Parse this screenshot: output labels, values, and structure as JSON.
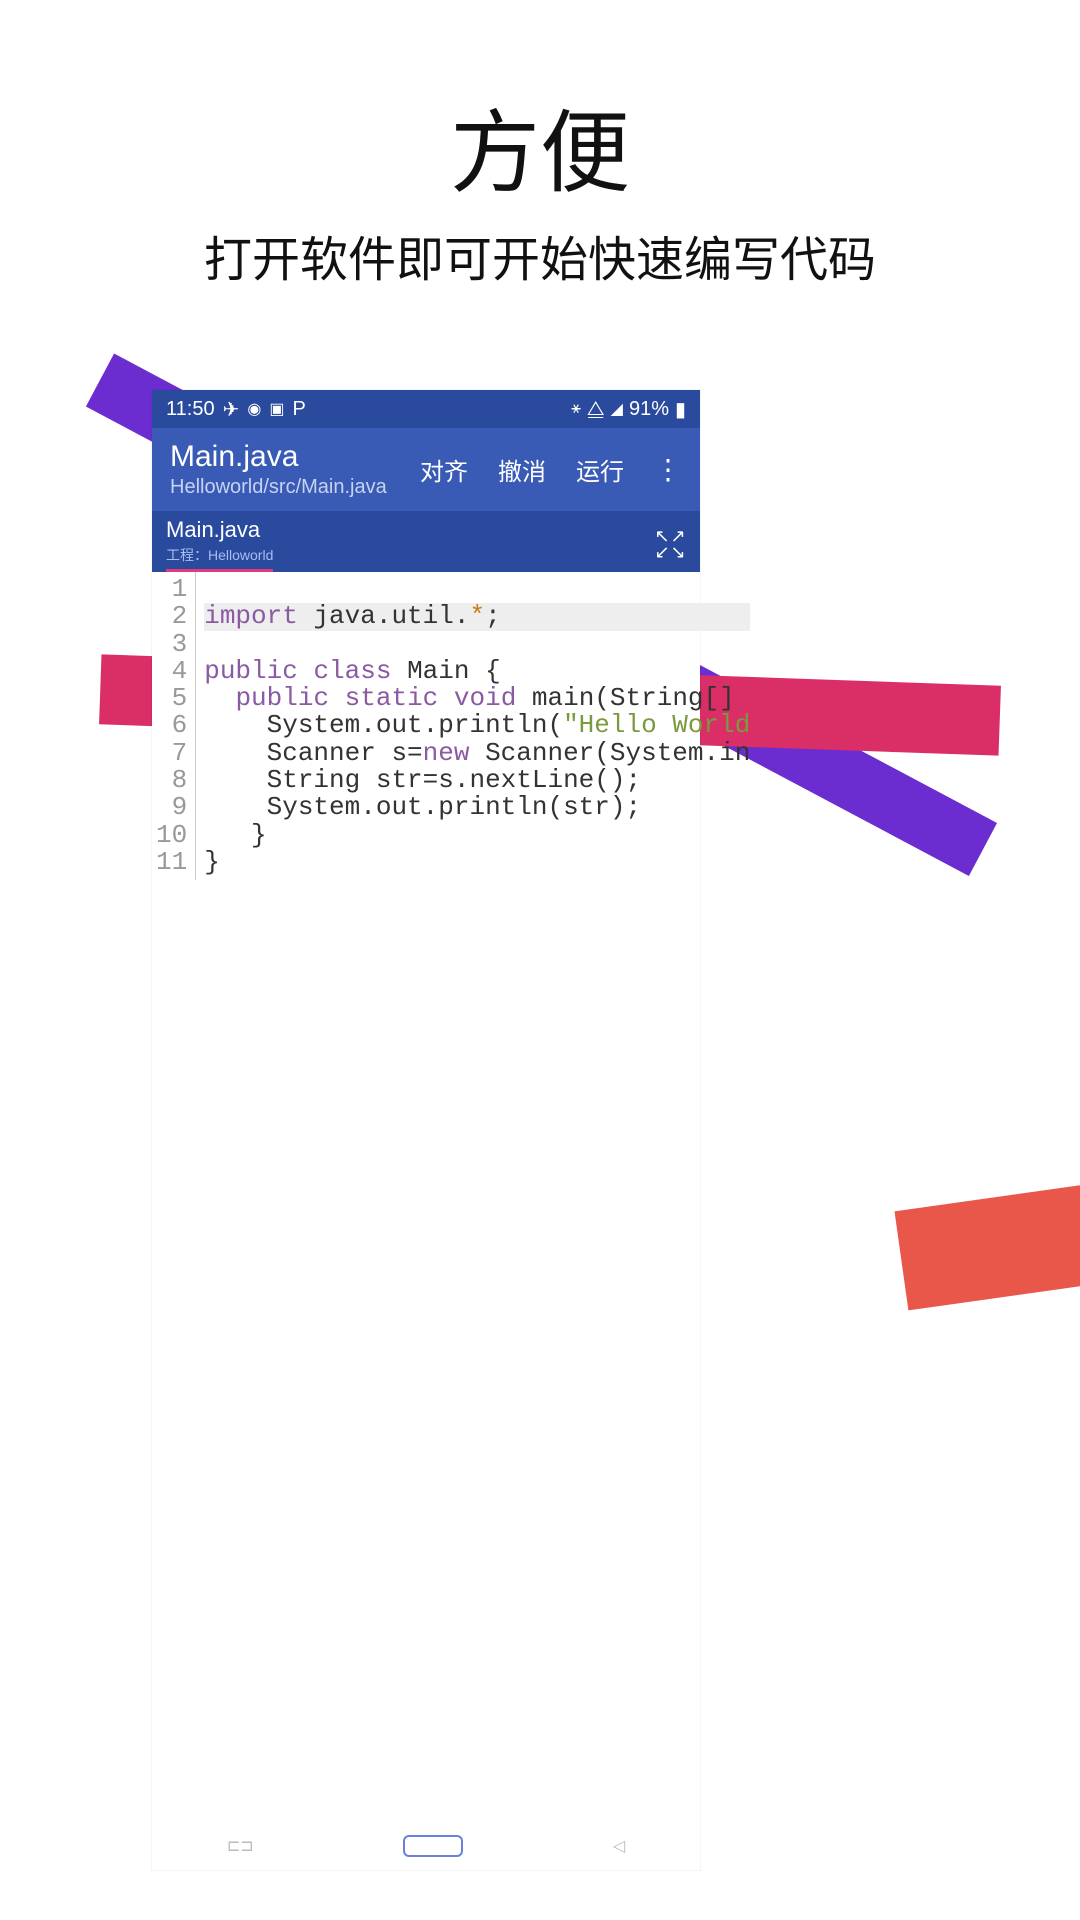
{
  "heading": {
    "title": "方便",
    "subtitle": "打开软件即可开始快速编写代码"
  },
  "status": {
    "time": "11:50",
    "battery": "91%"
  },
  "appbar": {
    "title": "Main.java",
    "subtitle": "Helloworld/src/Main.java",
    "actions": {
      "align": "对齐",
      "undo": "撤消",
      "run": "运行"
    }
  },
  "tab": {
    "name": "Main.java",
    "project_prefix": "工程：",
    "project_name": "Helloworld"
  },
  "code": {
    "line_numbers": [
      "1",
      "2",
      "3",
      "4",
      "5",
      "6",
      "7",
      "8",
      "9",
      "10",
      "11"
    ],
    "l1_import": "import",
    "l1_rest": " java.util.",
    "l1_star": "*",
    "l1_semi": ";",
    "l3_public": "public",
    "l3_class": " class",
    "l3_main": " Main {",
    "l4_ws": "  ",
    "l4_public": "public",
    "l4_static": " static",
    "l4_void": " void",
    "l4_main": " main(String[]",
    "l5": "    System.out.println(",
    "l5_str": "\"Hello World",
    "l6a": "    Scanner s=",
    "l6_new": "new",
    "l6b": " Scanner(System.in",
    "l7": "    String str=s.nextLine();",
    "l8": "    System.out.println(str);",
    "l9": "   }",
    "l10": "}"
  }
}
